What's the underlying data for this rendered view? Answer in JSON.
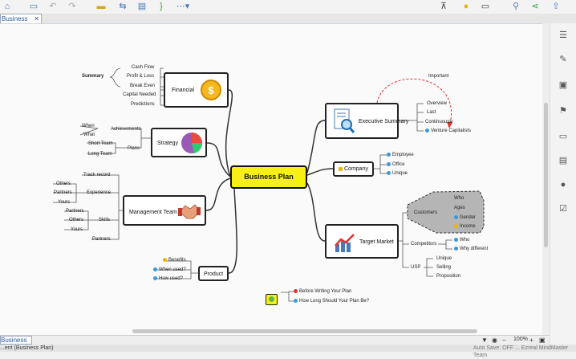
{
  "toolbar": {
    "icons": [
      "home-icon",
      "save-icon",
      "undo-icon",
      "redo-icon",
      "topic-icon",
      "relationship-icon",
      "summary-icon",
      "boundary-icon",
      "more-icon",
      "marker-icon",
      "idea-icon",
      "presentation-icon",
      "search-icon",
      "share-icon",
      "export-icon"
    ]
  },
  "tabs": [
    {
      "label": "Business Plan",
      "close": "✕"
    }
  ],
  "sidebar": {
    "icons": [
      "format-icon",
      "style-icon",
      "image-icon",
      "marker-flag-icon",
      "notes-icon",
      "outline-icon",
      "comment-icon",
      "task-icon"
    ]
  },
  "map": {
    "central": "Business Plan",
    "financial": {
      "label": "Financial",
      "summary_label": "Summary",
      "items": [
        "Cash Flow",
        "Profit & Loss",
        "Break Even",
        "Capital Needed",
        "Predictions"
      ]
    },
    "strategy": {
      "label": "Strategy",
      "achievements": "Achievements",
      "when": "When",
      "what": "What",
      "plans": "Plans",
      "short_team": "Short Team",
      "long_team": "Long Team"
    },
    "management": {
      "label": "Management Team",
      "track_record": "Track record",
      "experience": "Experience",
      "others": "Others",
      "partners": "Partners",
      "yours": "Yours",
      "skills": "Skills",
      "partners2": "Partners",
      "others2": "Others",
      "yours2": "Yours",
      "partners3": "Partners"
    },
    "product": {
      "label": "Product",
      "benefits": "Benefits",
      "when_used": "When used?",
      "how_used": "How used?"
    },
    "executive": {
      "label": "Executive Summary",
      "overview": "Overview",
      "last": "Last",
      "continuously": "Continuously",
      "venture": "Venture Capitalists",
      "relationship": "Important"
    },
    "company": {
      "label": "Company",
      "employee": "Employee",
      "office": "Office",
      "unique": "Unique"
    },
    "target": {
      "label": "Target Market",
      "customers": "Customers",
      "who": "Who",
      "ages": "Ages",
      "gender": "Gender",
      "income": "Income",
      "competitors": "Competitors",
      "who2": "Who",
      "why_different": "Why different",
      "usp": "USP",
      "unique2": "Unique",
      "selling": "Selling",
      "proposition": "Proposition"
    },
    "floating": {
      "before": "Before Writing Your Plan",
      "how_long": "How Long Should Your Plan Be?"
    }
  },
  "sheet": {
    "tab": "Business Plan"
  },
  "status": {
    "left": "...ent (Business Plan)",
    "zoom": "100%",
    "right": "Auto Save: OFF ... Ezreal MindMaster Team"
  }
}
